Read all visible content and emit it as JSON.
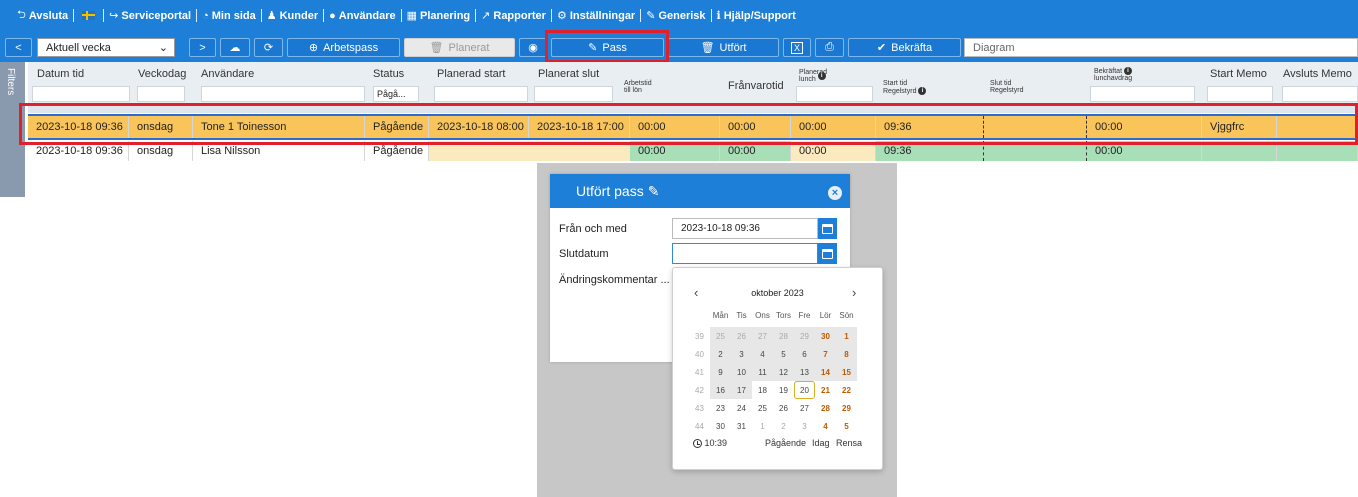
{
  "menu": [
    {
      "icon": "⮌",
      "label": "Avsluta"
    },
    {
      "icon": "flag",
      "label": ""
    },
    {
      "icon": "↪",
      "label": "Serviceportal"
    },
    {
      "icon": "◔",
      "label": "Min sida"
    },
    {
      "icon": "♟",
      "label": "Kunder"
    },
    {
      "icon": "👤",
      "label": "Användare"
    },
    {
      "icon": "▦",
      "label": "Planering"
    },
    {
      "icon": "↗",
      "label": "Rapporter"
    },
    {
      "icon": "⚙",
      "label": "Inställningar"
    },
    {
      "icon": "✎",
      "label": "Generisk"
    },
    {
      "icon": "ℹ",
      "label": "Hjälp/Support"
    }
  ],
  "toolbar": {
    "prev": "<",
    "week_select": "Aktuell vecka",
    "next": ">",
    "cloud_icon": "☁",
    "refresh_icon": "⟳",
    "arbetspass": "Arbetspass",
    "planerat": "Planerat",
    "eye_icon": "👁",
    "pass": "Pass",
    "utfort": "Utfört",
    "excel_icon": "X",
    "print_icon": "⎙",
    "bekrafta": "Bekräfta",
    "diagram_placeholder": "Diagram"
  },
  "filters_label": "Filters",
  "columns": {
    "datum_tid": "Datum tid",
    "veckodag": "Veckodag",
    "anvandare": "Användare",
    "status": "Status",
    "status_filter": "Pågå...",
    "planerad_start": "Planerad start",
    "planerat_slut": "Planerat slut",
    "arbetstid_1": "Arbetstid",
    "arbetstid_2": "till lön",
    "franvarotid": "Frånvarotid",
    "planerad_lunch_1": "Planerad",
    "planerad_lunch_2": "lunch",
    "start_tid_1": "Start tid",
    "start_tid_2": "Regelstyrd",
    "slut_tid_1": "Slut tid",
    "slut_tid_2": "Regelstyrd",
    "bekraftat_1": "Bekräftat",
    "bekraftat_2": "lunchavdrag",
    "start_memo": "Start Memo",
    "avsluts_memo": "Avsluts Memo"
  },
  "rows": [
    {
      "datum": "2023-10-18 09:36",
      "veckodag": "onsdag",
      "anvandare": "Tone 1 Toinesson",
      "status": "Pågående",
      "planerad_start": "2023-10-18 08:00",
      "planerat_slut": "2023-10-18 17:00",
      "arbetstid": "00:00",
      "franvaro": "00:00",
      "lunch": "00:00",
      "start_tid": "09:36",
      "slut_tid": "",
      "bekraftat": "00:00",
      "start_memo": "Vjggfrc",
      "avsluts_memo": ""
    },
    {
      "datum": "2023-10-18 09:36",
      "veckodag": "onsdag",
      "anvandare": "Lisa Nilsson",
      "status": "Pågående",
      "planerad_start": "",
      "planerat_slut": "",
      "arbetstid": "00:00",
      "franvaro": "00:00",
      "lunch": "00:00",
      "start_tid": "09:36",
      "slut_tid": "",
      "bekraftat": "00:00",
      "start_memo": "",
      "avsluts_memo": ""
    }
  ],
  "modal": {
    "title": "Utfört pass",
    "fran_label": "Från och med",
    "fran_value": "2023-10-18 09:36",
    "slut_label": "Slutdatum",
    "slut_value": "",
    "kommentar_label": "Ändringskommentar ..."
  },
  "picker": {
    "month": "oktober 2023",
    "weekday_headers": [
      "Mån",
      "Tis",
      "Ons",
      "Tors",
      "Fre",
      "Lör",
      "Sön"
    ],
    "weeks": [
      {
        "wk": "39",
        "days": [
          "25",
          "26",
          "27",
          "28",
          "29",
          "30",
          "1"
        ]
      },
      {
        "wk": "40",
        "days": [
          "2",
          "3",
          "4",
          "5",
          "6",
          "7",
          "8"
        ]
      },
      {
        "wk": "41",
        "days": [
          "9",
          "10",
          "11",
          "12",
          "13",
          "14",
          "15"
        ]
      },
      {
        "wk": "42",
        "days": [
          "16",
          "17",
          "18",
          "19",
          "20",
          "21",
          "22"
        ]
      },
      {
        "wk": "43",
        "days": [
          "23",
          "24",
          "25",
          "26",
          "27",
          "28",
          "29"
        ]
      },
      {
        "wk": "44",
        "days": [
          "30",
          "31",
          "1",
          "2",
          "3",
          "4",
          "5"
        ]
      }
    ],
    "time": "10:39",
    "pagaende": "Pågående",
    "idag": "Idag",
    "rensa": "Rensa"
  },
  "colors": {
    "brand_blue": "#1e7fd8",
    "selected_row": "#f9c55b",
    "highlight_red": "#e0202a",
    "green_cell": "#a8dfb7"
  }
}
